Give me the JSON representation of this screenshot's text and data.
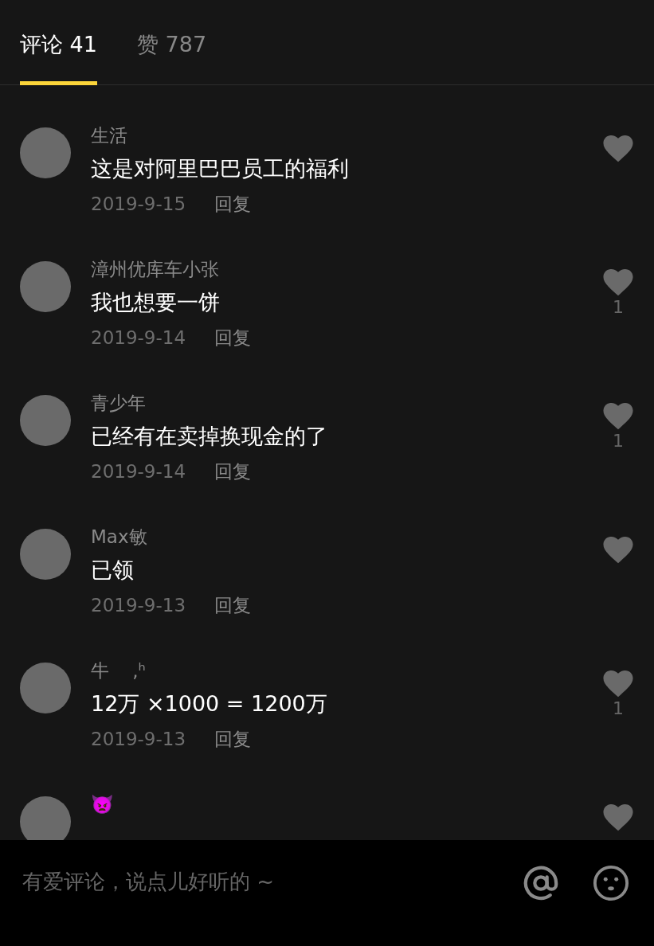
{
  "tabs": [
    {
      "label": "评论 41",
      "selected": true
    },
    {
      "label": "赞 787",
      "selected": false
    }
  ],
  "comments": [
    {
      "user": "生活",
      "text": "这是对阿里巴巴员工的福利",
      "date": "2019-9-15",
      "reply": "回复"
    },
    {
      "user": "漳州优库车小张",
      "text": "我也想要一饼",
      "date": "2019-9-14",
      "reply": "回复",
      "likes": "1"
    },
    {
      "user": "青少年",
      "text": "已经有在卖掉换现金的了",
      "date": "2019-9-14",
      "reply": "回复",
      "likes": "1"
    },
    {
      "user": "Max敏",
      "text": "已领",
      "date": "2019-9-13",
      "reply": "回复"
    },
    {
      "user": "牛    ,ʰ",
      "text": "12万 ×1000 = 1200万",
      "date": "2019-9-13",
      "reply": "回复",
      "likes": "1"
    },
    {
      "user": "👿"
    }
  ],
  "input": {
    "placeholder": "有爱评论，说点儿好听的 ~"
  }
}
